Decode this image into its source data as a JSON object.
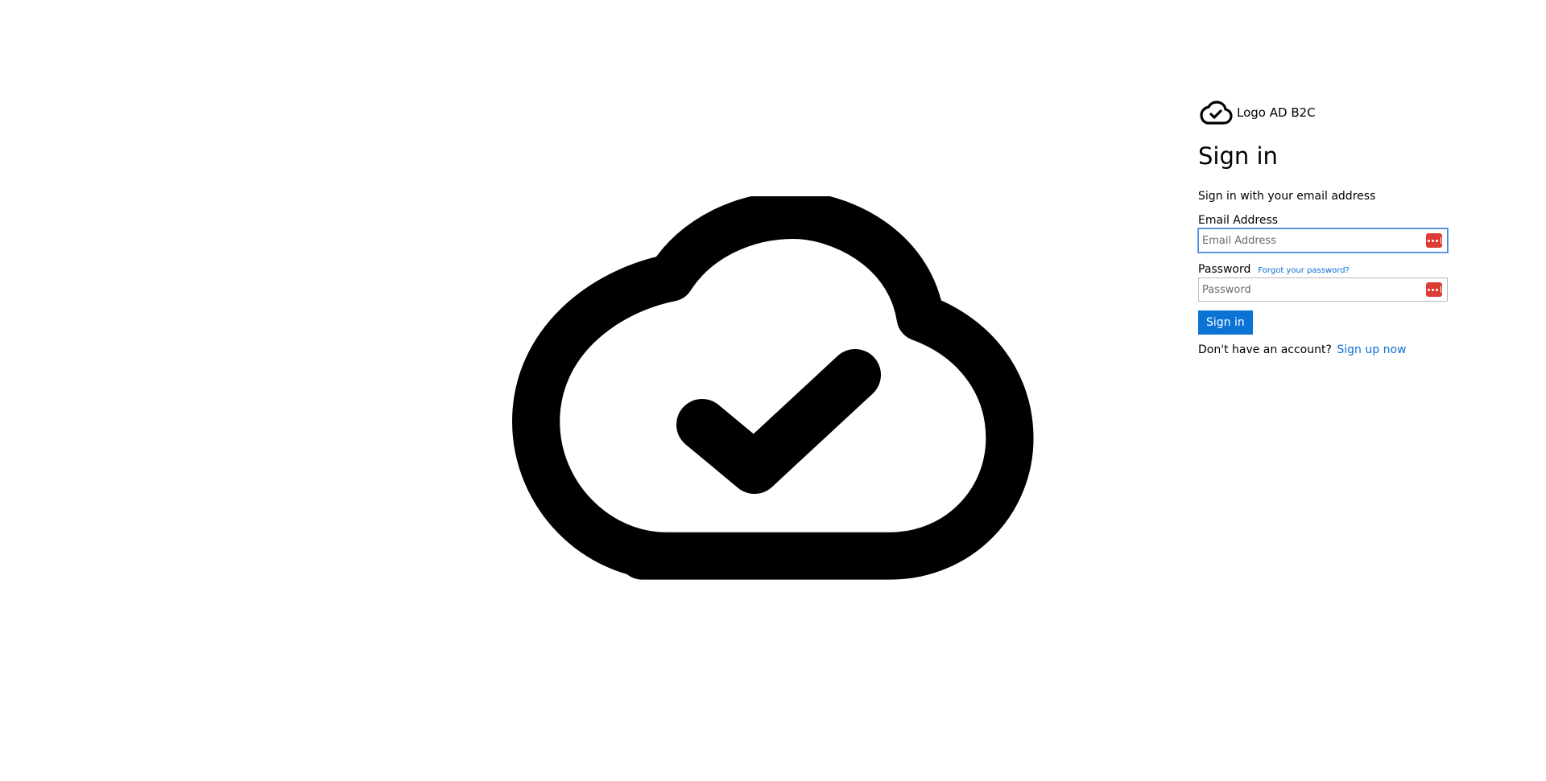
{
  "brand": {
    "logo_icon": "cloud-check-icon",
    "name": "Logo AD B2C"
  },
  "hero": {
    "icon": "cloud-check-icon"
  },
  "form": {
    "title": "Sign in",
    "intro": "Sign in with your email address",
    "email": {
      "label": "Email Address",
      "placeholder": "Email Address",
      "value": ""
    },
    "password": {
      "label": "Password",
      "placeholder": "Password",
      "value": "",
      "forgot_link": "Forgot your password?"
    },
    "password_manager_icon": "password-manager-icon",
    "submit_label": "Sign in",
    "signup_prompt": "Don't have an account?",
    "signup_link": "Sign up now"
  },
  "colors": {
    "accent": "#0b72d6",
    "link": "#0a6ed1",
    "password_manager": "#dd3b35"
  }
}
